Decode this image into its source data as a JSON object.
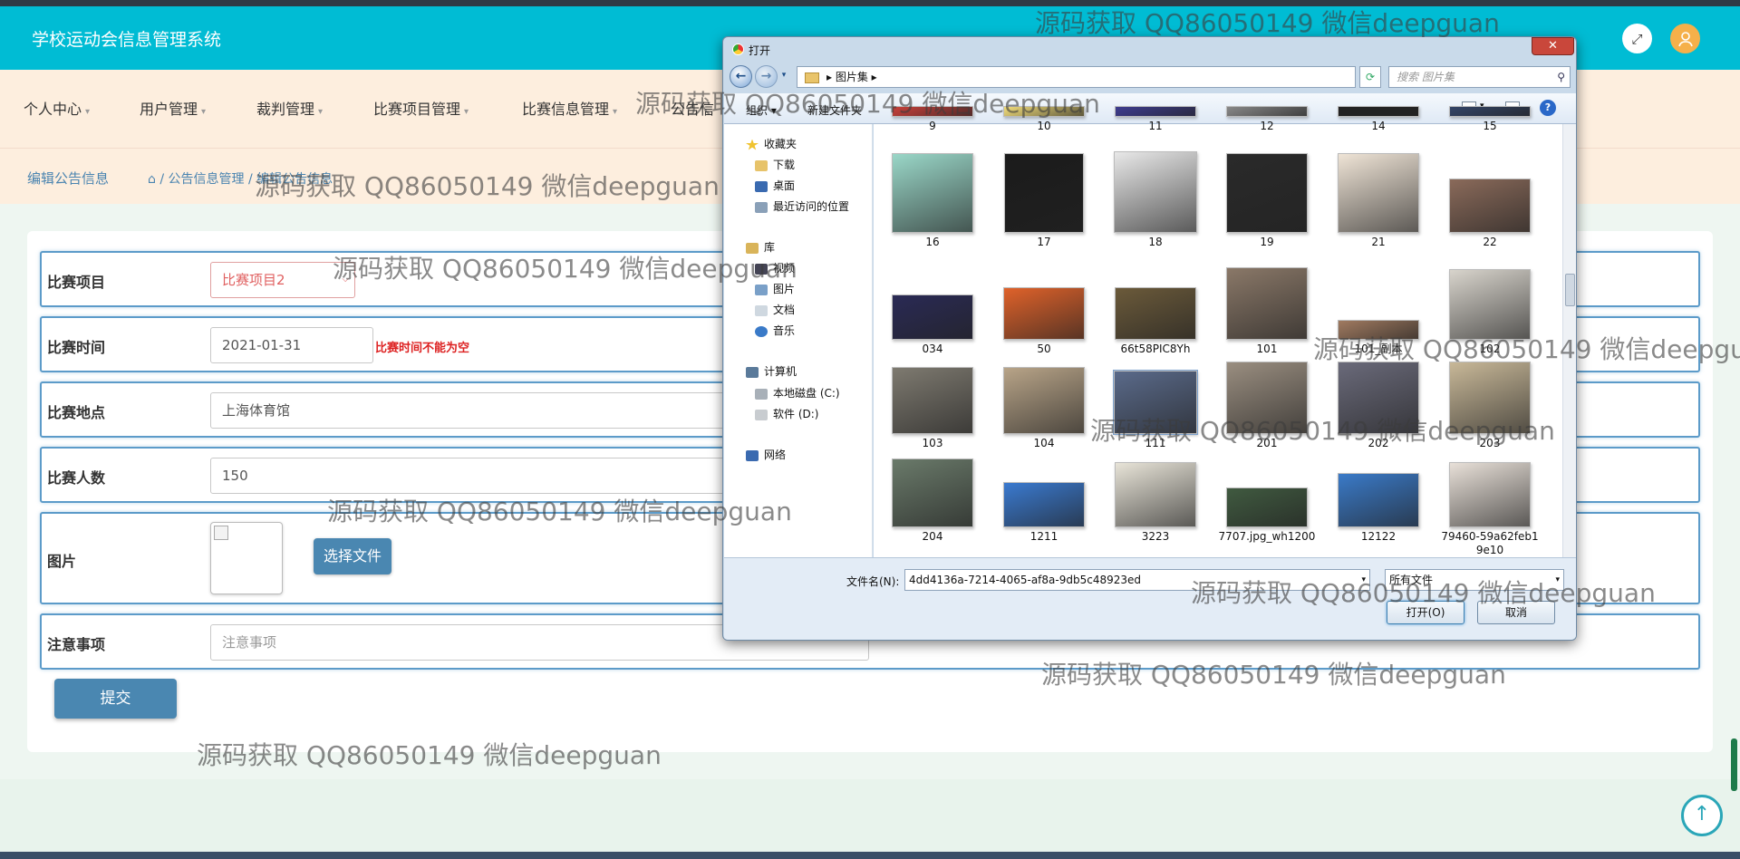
{
  "header": {
    "title": "学校运动会信息管理系统"
  },
  "menu": [
    {
      "label": "个人中心"
    },
    {
      "label": "用户管理"
    },
    {
      "label": "裁判管理"
    },
    {
      "label": "比赛项目管理"
    },
    {
      "label": "比赛信息管理"
    },
    {
      "label": "公告信"
    }
  ],
  "breadcrumb": {
    "title": "编辑公告信息",
    "path": "公告信息管理",
    "current": "编辑公告信息"
  },
  "form": {
    "project_label": "比赛项目",
    "project_value": "比赛项目2",
    "time_label": "比赛时间",
    "time_value": "2021-01-31",
    "time_error": "比赛时间不能为空",
    "place_label": "比赛地点",
    "place_value": "上海体育馆",
    "count_label": "比赛人数",
    "count_value": "150",
    "image_label": "图片",
    "choose_file": "选择文件",
    "notes_label": "注意事项",
    "notes_placeholder": "注意事项",
    "submit": "提交"
  },
  "dialog": {
    "title": "打开",
    "address": "图片集",
    "search_placeholder": "搜索 图片集",
    "organize": "组织",
    "new_folder": "新建文件夹",
    "nav": [
      {
        "label": "收藏夹",
        "icon": "star-icon"
      },
      {
        "label": "下载",
        "icon": "download-folder-icon"
      },
      {
        "label": "桌面",
        "icon": "desktop-icon"
      },
      {
        "label": "最近访问的位置",
        "icon": "recent-places-icon"
      },
      {
        "label": "库",
        "icon": "library-icon"
      },
      {
        "label": "视频",
        "icon": "video-icon"
      },
      {
        "label": "图片",
        "icon": "pictures-icon"
      },
      {
        "label": "文档",
        "icon": "documents-icon"
      },
      {
        "label": "音乐",
        "icon": "music-icon"
      },
      {
        "label": "计算机",
        "icon": "computer-icon"
      },
      {
        "label": "本地磁盘 (C:)",
        "icon": "drive-icon"
      },
      {
        "label": "软件 (D:)",
        "icon": "drive-icon"
      },
      {
        "label": "网络",
        "icon": "network-icon"
      }
    ],
    "files": [
      {
        "name": "9",
        "color": "#c8403a"
      },
      {
        "name": "10",
        "color": "#f1dc7a"
      },
      {
        "name": "11",
        "color": "#3e3c8e"
      },
      {
        "name": "12",
        "color": "#888888"
      },
      {
        "name": "14",
        "color": "#222222"
      },
      {
        "name": "15",
        "color": "#334466"
      },
      {
        "name": "16",
        "color": "#9ad7c8"
      },
      {
        "name": "17",
        "color": "#1b1b1b"
      },
      {
        "name": "18",
        "color": "#e8e8e8"
      },
      {
        "name": "19",
        "color": "#2a2a2a"
      },
      {
        "name": "21",
        "color": "#efe4d6"
      },
      {
        "name": "22",
        "color": "#8a6a5a"
      },
      {
        "name": "034",
        "color": "#2a2a55"
      },
      {
        "name": "50",
        "color": "#e0622a"
      },
      {
        "name": "66t58PIC8Yh",
        "color": "#6b5a3a"
      },
      {
        "name": "101",
        "color": "#8a7868"
      },
      {
        "name": "101_副本",
        "color": "#a07a60"
      },
      {
        "name": "102",
        "color": "#d8d4cc"
      },
      {
        "name": "103",
        "color": "#7e7a70"
      },
      {
        "name": "104",
        "color": "#b8a488"
      },
      {
        "name": "111",
        "color": "#5a6a8a"
      },
      {
        "name": "201",
        "color": "#9a8e80"
      },
      {
        "name": "202",
        "color": "#6a6a7a"
      },
      {
        "name": "203",
        "color": "#c8b898"
      },
      {
        "name": "204",
        "color": "#6a7a6a"
      },
      {
        "name": "1211",
        "color": "#3a7ad0"
      },
      {
        "name": "3223",
        "color": "#e8e4d8"
      },
      {
        "name": "7707.jpg_wh1200",
        "color": "#405a40"
      },
      {
        "name": "12122",
        "color": "#3a7ac8"
      },
      {
        "name": "79460-59a62feb19e10",
        "color": "#e8e0d8"
      }
    ],
    "filename_label": "文件名(N):",
    "filename_value": "4dd4136a-7214-4065-af8a-9db5c48923ed",
    "filetype_value": "所有文件",
    "open_button": "打开(O)",
    "cancel_button": "取消"
  },
  "watermark": "源码获取 QQ86050149 微信deepguan"
}
